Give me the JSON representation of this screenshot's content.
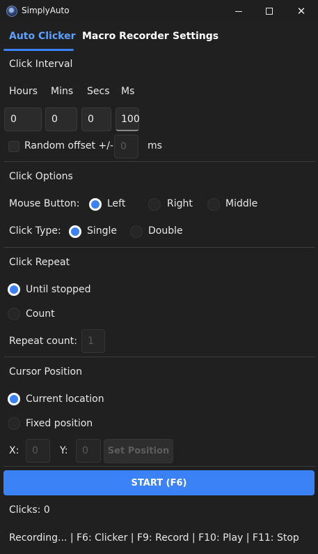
{
  "window": {
    "title": "SimplyAuto",
    "controls": {
      "minimize": "minimize",
      "maximize": "maximize",
      "close": "✕"
    }
  },
  "tabs": [
    {
      "label": "Auto Clicker",
      "active": true
    },
    {
      "label": "Macro Recorder",
      "active": false
    },
    {
      "label": "Settings",
      "active": false
    }
  ],
  "click_interval": {
    "heading": "Click Interval",
    "labels": [
      "Hours",
      "Mins",
      "Secs",
      "Ms"
    ],
    "values": [
      "0",
      "0",
      "0",
      "100"
    ],
    "random_offset_label": "Random offset +/-",
    "random_offset_checked": false,
    "random_offset_value": "0",
    "random_offset_unit": "ms"
  },
  "click_options": {
    "heading": "Click Options",
    "mouse_button_label": "Mouse Button:",
    "mouse_buttons": [
      "Left",
      "Right",
      "Middle"
    ],
    "mouse_button_selected": "Left",
    "click_type_label": "Click Type:",
    "click_types": [
      "Single",
      "Double"
    ],
    "click_type_selected": "Single"
  },
  "click_repeat": {
    "heading": "Click Repeat",
    "options": [
      "Until stopped",
      "Count"
    ],
    "selected": "Until stopped",
    "repeat_count_label": "Repeat count:",
    "repeat_count_value": "1"
  },
  "cursor_position": {
    "heading": "Cursor Position",
    "options": [
      "Current location",
      "Fixed position"
    ],
    "selected": "Current location",
    "x_label": "X:",
    "x_value": "0",
    "y_label": "Y:",
    "y_value": "0",
    "set_position_label": "Set Position"
  },
  "start_button_label": "START (F6)",
  "clicks_status": "Clicks: 0",
  "status_bar": "Recording... | F6: Clicker | F9: Record | F10: Play | F11: Stop",
  "colors": {
    "accent": "#3b82f6",
    "background": "#202020",
    "active_tab_text": "#5da0ff"
  }
}
